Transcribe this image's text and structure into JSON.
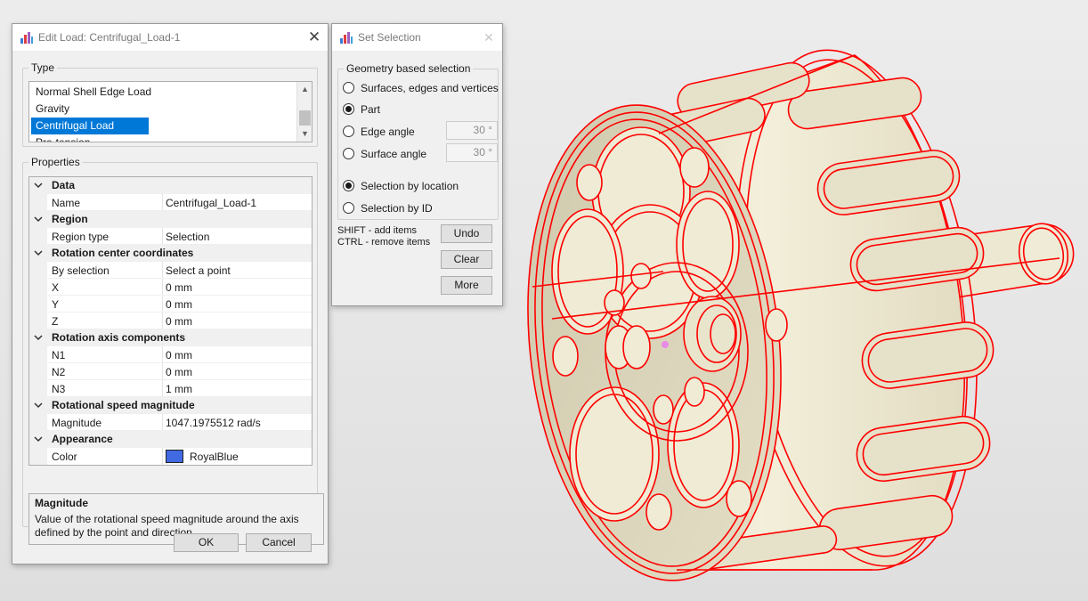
{
  "edit_load": {
    "title": "Edit Load: Centrifugal_Load-1",
    "type_group": "Type",
    "type_list": [
      "Normal Shell Edge Load",
      "Gravity",
      "Centrifugal Load",
      "Pre-tension"
    ],
    "selected_type": "Centrifugal Load",
    "properties_group": "Properties",
    "categories": {
      "data": "Data",
      "region": "Region",
      "rotation_center": "Rotation center coordinates",
      "rotation_axis": "Rotation axis components",
      "rotational_speed": "Rotational speed magnitude",
      "appearance": "Appearance"
    },
    "props": {
      "name": {
        "label": "Name",
        "value": "Centrifugal_Load-1"
      },
      "region_type": {
        "label": "Region type",
        "value": "Selection"
      },
      "by_selection": {
        "label": "By selection",
        "value": "Select a point"
      },
      "x": {
        "label": "X",
        "value": "0 mm"
      },
      "y": {
        "label": "Y",
        "value": "0 mm"
      },
      "z": {
        "label": "Z",
        "value": "0 mm"
      },
      "n1": {
        "label": "N1",
        "value": "0 mm"
      },
      "n2": {
        "label": "N2",
        "value": "0 mm"
      },
      "n3": {
        "label": "N3",
        "value": "1 mm"
      },
      "magnitude": {
        "label": "Magnitude",
        "value": "1047.1975512 rad/s"
      },
      "color": {
        "label": "Color",
        "value": "RoyalBlue",
        "swatch": "#4169e1"
      }
    },
    "description": {
      "title": "Magnitude",
      "text": "Value of the rotational speed magnitude around the axis defined by the point and direction."
    },
    "ok_label": "OK",
    "cancel_label": "Cancel"
  },
  "set_selection": {
    "title": "Set Selection",
    "group": "Geometry based selection",
    "options": {
      "surfaces": "Surfaces, edges and vertices",
      "part": "Part",
      "edge_angle": "Edge angle",
      "surface_angle": "Surface angle",
      "by_location": "Selection by location",
      "by_id": "Selection by ID"
    },
    "selected_geometry": "Part",
    "selected_mode": "Selection by location",
    "edge_angle_value": "30 °",
    "surface_angle_value": "30 °",
    "hint_shift": "SHIFT - add items",
    "hint_ctrl": "CTRL - remove items",
    "undo_label": "Undo",
    "clear_label": "Clear",
    "more_label": "More"
  },
  "colors": {
    "selection_blue": "#0078d7",
    "model_edge_red": "#ff0000",
    "model_surface": "#efebd4",
    "selection_point": "#e88ae8"
  },
  "icons": [
    "app-icon",
    "close-icon",
    "chevron-down-icon",
    "scroll-up-icon",
    "scroll-down-icon"
  ]
}
